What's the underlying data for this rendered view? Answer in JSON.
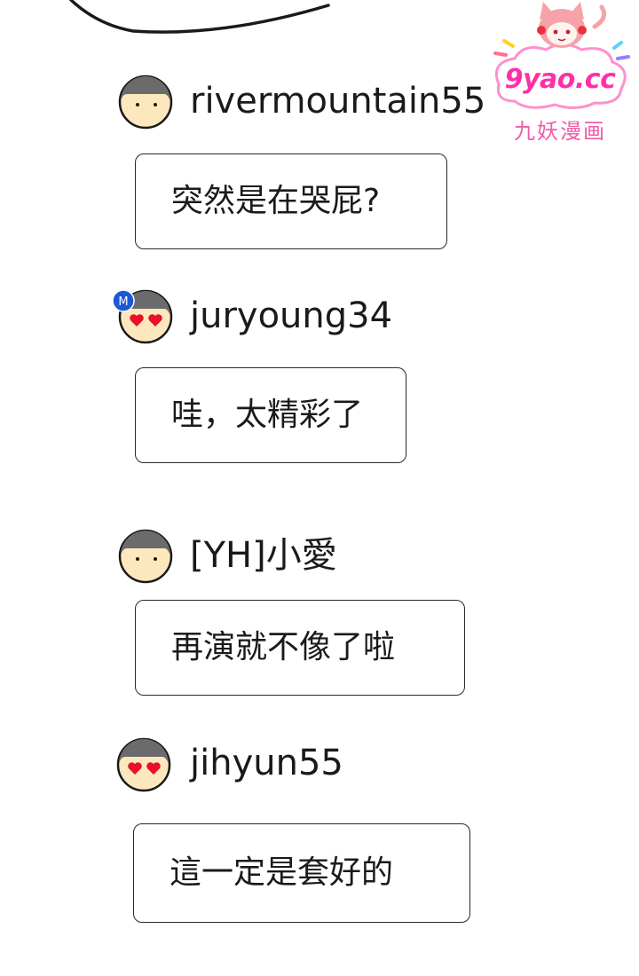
{
  "watermark": {
    "site": "9yao.cc",
    "name": "九妖漫画"
  },
  "comments": [
    {
      "username": "rivermountain55",
      "text": "突然是在哭屁?",
      "avatar": "plain-face-icon"
    },
    {
      "username": "juryoung34",
      "text": "哇，太精彩了",
      "avatar": "heart-eyes-face-icon",
      "badge": "M"
    },
    {
      "username": "[YH]小愛",
      "text": "再演就不像了啦",
      "avatar": "plain-face-icon"
    },
    {
      "username": "jihyun55",
      "text": "這一定是套好的",
      "avatar": "heart-eyes-face-icon"
    }
  ],
  "colors": {
    "skin": "#fde8bd",
    "hair": "#6b6b6b",
    "heart": "#e8102a",
    "badge": "#1c58d6",
    "watermark_pink": "#ff2fa8"
  }
}
